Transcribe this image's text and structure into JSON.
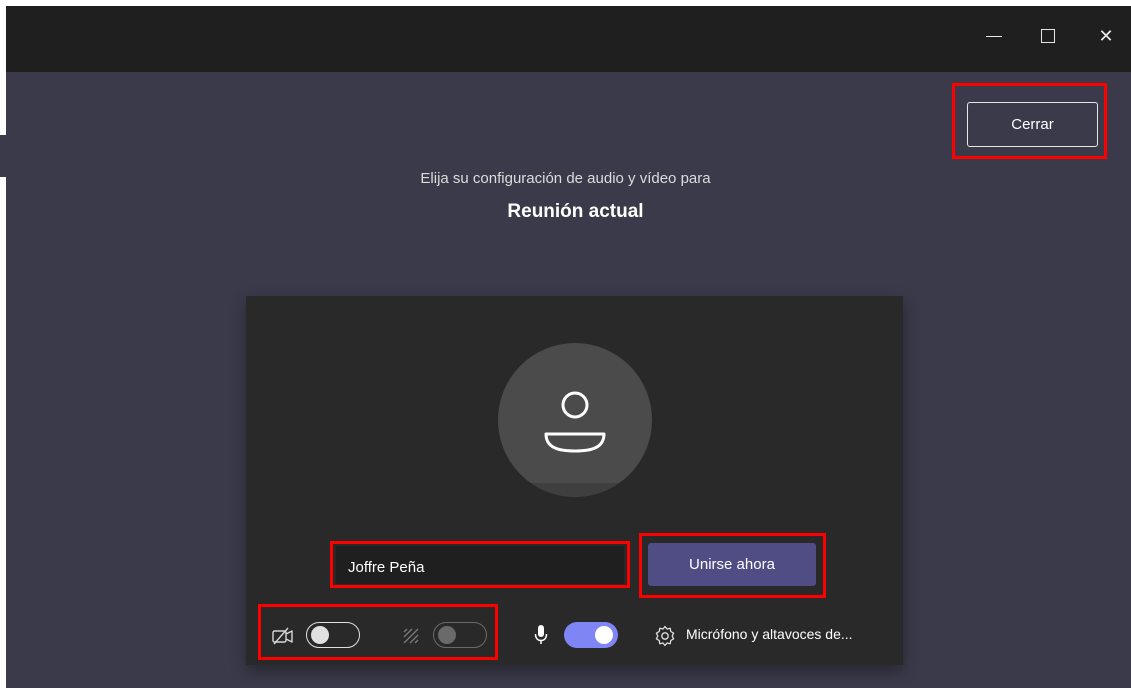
{
  "window": {
    "controls": {
      "minimize_icon": "minimize-icon",
      "maximize_icon": "maximize-icon",
      "close_symbol": "✕"
    }
  },
  "header": {
    "close_label": "Cerrar",
    "subtitle": "Elija su configuración de audio y vídeo para",
    "meeting_title": "Reunión actual"
  },
  "prejoin": {
    "avatar_icon": "person-icon",
    "name_value": "Joffre Peña",
    "join_label": "Unirse ahora",
    "controls": {
      "camera": {
        "icon": "camera-off-icon",
        "state": "off"
      },
      "background": {
        "icon": "background-blur-icon",
        "state": "off-disabled"
      },
      "microphone": {
        "icon": "microphone-icon",
        "state": "on"
      },
      "device_settings": {
        "icon": "gear-icon",
        "label": "Micrófono y altavoces de..."
      }
    }
  },
  "colors": {
    "titlebar": "#1f1f1f",
    "stage": "#3b3a4a",
    "panel": "#292929",
    "accent": "#4f4d84",
    "toggle_on": "#7f85f5",
    "highlight": "#ff0000"
  }
}
